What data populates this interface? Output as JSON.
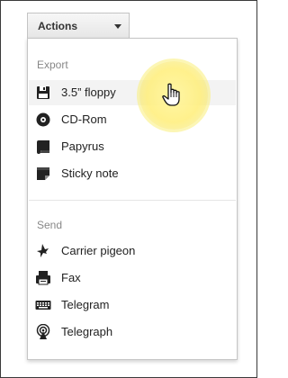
{
  "toolbar": {
    "actions_label": "Actions"
  },
  "menu": {
    "export_header": "Export",
    "export_items": [
      {
        "label": "3.5” floppy",
        "icon": "floppy-disk-icon"
      },
      {
        "label": "CD-Rom",
        "icon": "cd-icon"
      },
      {
        "label": "Papyrus",
        "icon": "scroll-icon"
      },
      {
        "label": "Sticky note",
        "icon": "sticky-note-icon"
      }
    ],
    "send_header": "Send",
    "send_items": [
      {
        "label": "Carrier pigeon",
        "icon": "pigeon-icon"
      },
      {
        "label": "Fax",
        "icon": "fax-icon"
      },
      {
        "label": "Telegram",
        "icon": "keyboard-icon"
      },
      {
        "label": "Telegraph",
        "icon": "telegraph-icon"
      }
    ]
  },
  "colors": {
    "highlight": "#f9ee7a",
    "hover_row": "#f3f3f3",
    "header_text": "#888888"
  }
}
